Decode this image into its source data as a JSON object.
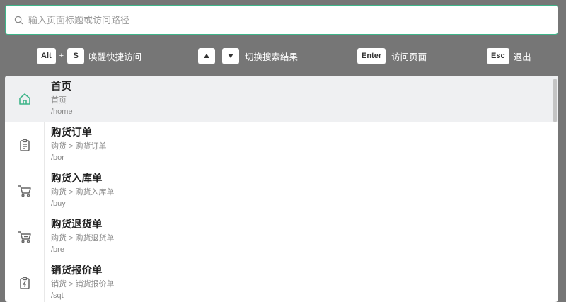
{
  "search": {
    "placeholder": "输入页面标题或访问路径",
    "value": ""
  },
  "hints": {
    "wake": {
      "keys": [
        "Alt",
        "S"
      ],
      "joiner": "+",
      "label": "唤醒快捷访问"
    },
    "switch": {
      "keys": [
        "▲",
        "▼"
      ],
      "label": "切换搜索结果"
    },
    "visit": {
      "keys": [
        "Enter"
      ],
      "label": "访问页面"
    },
    "exit": {
      "keys": [
        "Esc"
      ],
      "label": "退出"
    }
  },
  "results": [
    {
      "title": "首页",
      "breadcrumb": "首页",
      "path": "/home",
      "icon": "home-icon",
      "active": true
    },
    {
      "title": "购货订单",
      "breadcrumb": "购货 > 购货订单",
      "path": "/bor",
      "icon": "clipboard-list-icon",
      "active": false
    },
    {
      "title": "购货入库单",
      "breadcrumb": "购货 > 购货入库单",
      "path": "/buy",
      "icon": "cart-icon",
      "active": false
    },
    {
      "title": "购货退货单",
      "breadcrumb": "购货 > 购货退货单",
      "path": "/bre",
      "icon": "cart-return-icon",
      "active": false
    },
    {
      "title": "销货报价单",
      "breadcrumb": "销货 > 销货报价单",
      "path": "/sqt",
      "icon": "clipboard-bolt-icon",
      "active": false
    }
  ],
  "colors": {
    "accent": "#3fb58a",
    "overlay": "#767676",
    "active_row": "#eff0f2"
  }
}
